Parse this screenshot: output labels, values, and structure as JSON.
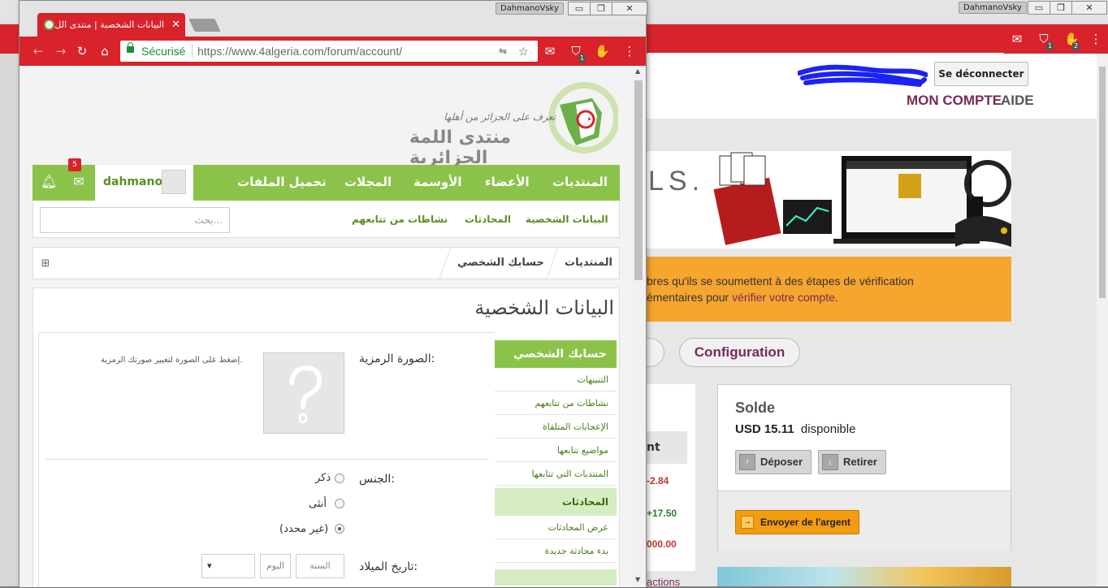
{
  "back_window": {
    "user_badge": "DahmanoVsky",
    "win_controls": {
      "minimize": "▭",
      "restore": "❐",
      "close": "✕"
    },
    "toolbar_badges": [
      "1",
      "2"
    ],
    "header": {
      "logout_label": "Se déconnecter",
      "nav_account": "MON COMPTE",
      "nav_help": "AIDE"
    },
    "banner_text": "LS.",
    "warning": {
      "line1": "bres qu'ils se soumettent à des étapes de vérification",
      "line2_pre": "émentaires pour ",
      "line2_link": "vérifier votre compte",
      "line2_post": "."
    },
    "pill_partial": "s",
    "pill_config": "Configuration",
    "table_header_partial": "nt",
    "amounts": [
      "-2.84",
      "+17.50",
      "000.00"
    ],
    "transactions_partial": "actions",
    "balance": {
      "title": "Solde",
      "amount": "USD 15.11",
      "suffix": "disponible",
      "deposit": "Déposer",
      "withdraw": "Retirer",
      "send": "Envoyer de l'argent"
    }
  },
  "front_window": {
    "user_badge": "DahmanoVsky",
    "tab_title": "البيانات الشخصية | منتدى الل",
    "omnibox": {
      "secure_label": "Sécurisé",
      "url_host": "https://www.4algeria.com",
      "url_path": "/forum/account/"
    },
    "toolbar_badge": "1",
    "logo": {
      "slogan": "تعرف على الجزائر من أهلها",
      "name": "منتدى اللمة الجزائرية"
    },
    "nav": {
      "items": [
        "المنتديات",
        "الأعضاء",
        "الأوسمة",
        "المجلات",
        "تحميل الملفات"
      ],
      "username": "dahmano",
      "mail_count": "5"
    },
    "subnav": {
      "items": [
        "البيانات الشخصية",
        "المحادثات",
        "نشاطات من تتابعهم"
      ],
      "search_placeholder": "بحث..."
    },
    "breadcrumbs": [
      "المنتديات",
      "حسابك الشخصي"
    ],
    "page_title": "البيانات الشخصية",
    "sidebar": {
      "header1": "حسابك الشخصي",
      "links1": [
        "التنبيهات",
        "نشاطات من تتابعهم",
        "الإعجابات المتلقاة",
        "مواضيع تتابعها",
        "المنتديات التي تتابعها"
      ],
      "header2": "المحادثات",
      "links2": [
        "عرض المحادثات",
        "بدء محادثة جديدة"
      ]
    },
    "form": {
      "avatar_label": "الصورة الرمزية:",
      "avatar_hint": "إضغط على الصورة لتغيير صورتك الرمزية.",
      "gender_label": "الجنس:",
      "gender_options": [
        "ذكر",
        "أنثى",
        "(غير محدد)"
      ],
      "gender_selected": "(غير محدد)",
      "birth_label": "تاريخ الميلاد:",
      "year_placeholder": "السنة",
      "day_placeholder": "اليوم",
      "month_arrow": "▾"
    }
  },
  "colors": {
    "chrome_red": "#d8232a",
    "forum_green": "#8bc34a",
    "brand_purple": "#7a2a57",
    "warning_orange": "#f6a52f"
  }
}
